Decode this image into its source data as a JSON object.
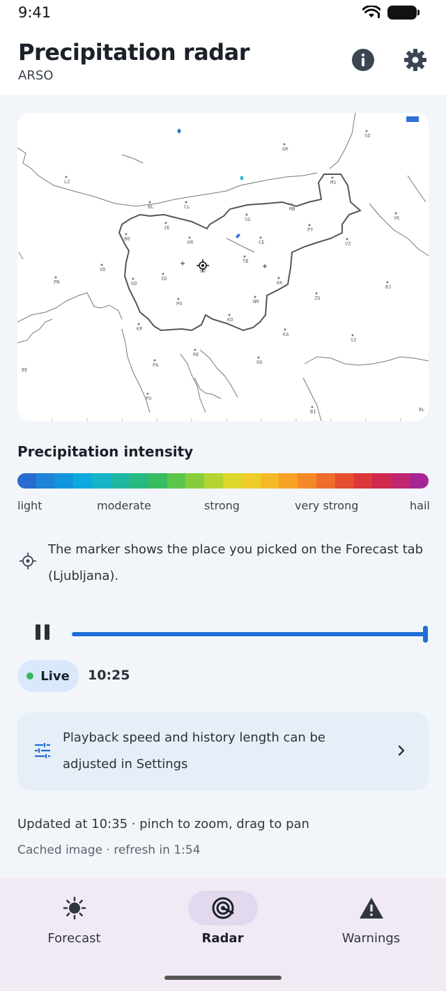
{
  "status_bar": {
    "time": "9:41"
  },
  "header": {
    "title": "Precipitation radar",
    "subtitle": "ARSO"
  },
  "map": {
    "city_labels": [
      {
        "code": "SO"
      },
      {
        "code": "GR"
      },
      {
        "code": "LZ"
      },
      {
        "code": "BL"
      },
      {
        "code": "CL"
      },
      {
        "code": "SG"
      },
      {
        "code": "MB"
      },
      {
        "code": "MS"
      },
      {
        "code": "VK"
      },
      {
        "code": "JE"
      },
      {
        "code": "PT"
      },
      {
        "code": "BO"
      },
      {
        "code": "KR"
      },
      {
        "code": "CE"
      },
      {
        "code": "VZ"
      },
      {
        "code": "VD"
      },
      {
        "code": "LJ"
      },
      {
        "code": "TB"
      },
      {
        "code": "PN"
      },
      {
        "code": "GO"
      },
      {
        "code": "ID"
      },
      {
        "code": "KK"
      },
      {
        "code": "BJ"
      },
      {
        "code": "ZG"
      },
      {
        "code": "PO"
      },
      {
        "code": "NM"
      },
      {
        "code": "KO"
      },
      {
        "code": "KA"
      },
      {
        "code": "SI"
      },
      {
        "code": "KP"
      },
      {
        "code": "RE"
      },
      {
        "code": "OG"
      },
      {
        "code": "PA"
      },
      {
        "code": "PU"
      },
      {
        "code": "BI"
      },
      {
        "code": "BL"
      },
      {
        "code": "BE"
      }
    ]
  },
  "legend": {
    "title": "Precipitation intensity",
    "colors": [
      "#2a6bd1",
      "#1e84d8",
      "#1196dc",
      "#0aa9de",
      "#17b3c7",
      "#1fb7a2",
      "#27b980",
      "#37bd60",
      "#5cc64c",
      "#86cc3c",
      "#b3d433",
      "#dcd72b",
      "#eecd2b",
      "#f5b928",
      "#f6a226",
      "#f5892a",
      "#ee6c2c",
      "#e54e2e",
      "#dd363b",
      "#d0294f",
      "#c02670",
      "#a72594"
    ],
    "labels": [
      "light",
      "moderate",
      "strong",
      "very strong",
      "hail"
    ]
  },
  "marker_note": "The marker shows the place you picked on the Forecast tab (Ljubljana).",
  "player": {
    "progress": 1.0
  },
  "live": {
    "label": "Live",
    "time": "10:25"
  },
  "settings_hint": {
    "text": "Playback speed and history length can be adjusted in Settings"
  },
  "footer": {
    "updated": "Updated at 10:35 · pinch to zoom, drag to pan",
    "cached": "Cached image · refresh in 1:54"
  },
  "nav": {
    "items": [
      {
        "label": "Forecast",
        "icon": "sun-icon",
        "active": false
      },
      {
        "label": "Radar",
        "icon": "radar-icon",
        "active": true
      },
      {
        "label": "Warnings",
        "icon": "warning-icon",
        "active": false
      }
    ]
  }
}
